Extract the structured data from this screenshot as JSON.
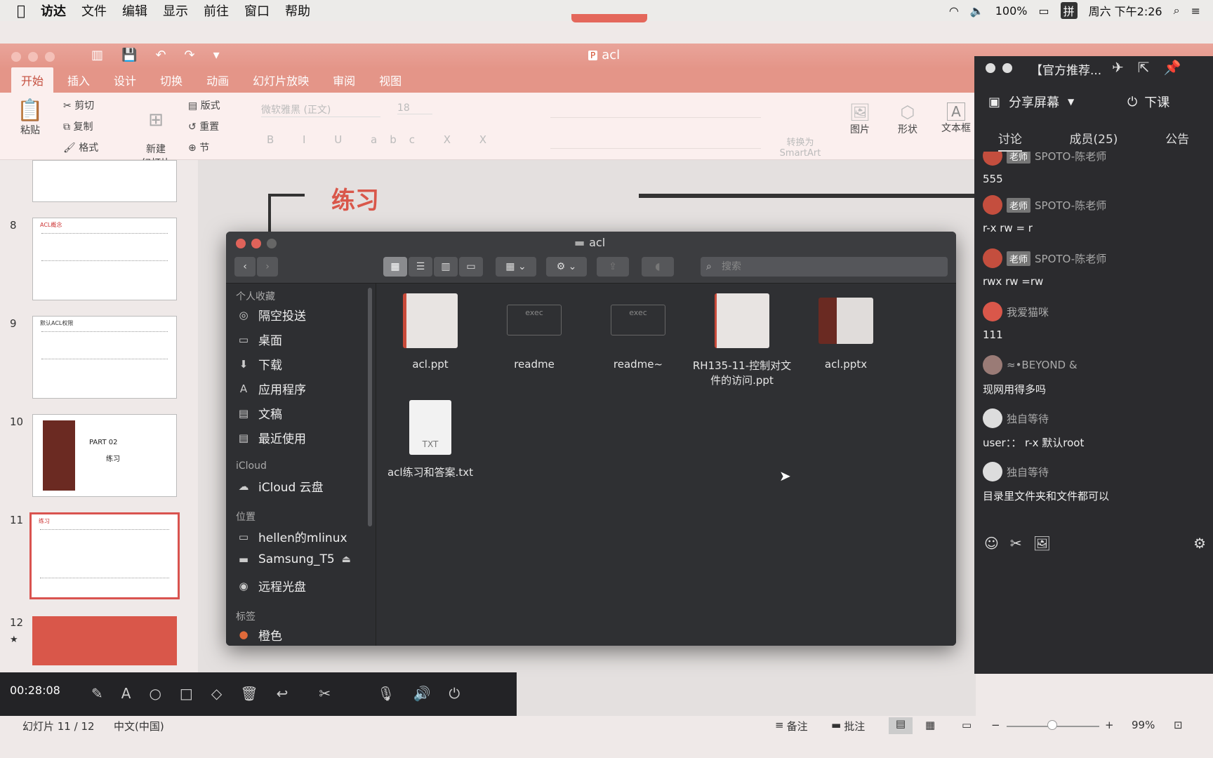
{
  "menubar": {
    "apple": "",
    "items": [
      "访达",
      "文件",
      "编辑",
      "显示",
      "前往",
      "窗口",
      "帮助"
    ],
    "battery": "100%",
    "input_method": "拼",
    "clock": "周六 下午2:26"
  },
  "ppt": {
    "title": "acl",
    "tabs": [
      "开始",
      "插入",
      "设计",
      "切换",
      "动画",
      "幻灯片放映",
      "审阅",
      "视图"
    ],
    "ribbon": {
      "paste": "粘贴",
      "cut": "剪切",
      "copy": "复制",
      "format": "格式",
      "new_slide": "新建\n幻灯片",
      "layout": "版式",
      "reset": "重置",
      "section": "节",
      "font_name": "微软雅黑 (正文)",
      "font_size": "18",
      "smartart": "转换为\nSmartArt",
      "picture": "图片",
      "shape": "形状",
      "textbox": "文本框"
    },
    "slide_numbers": [
      "8",
      "9",
      "10",
      "11",
      "12"
    ],
    "thumb10_text": [
      "PART 02",
      "练习"
    ],
    "thumb8_title": "ACL概念",
    "thumb9_title": "默认ACL权限",
    "thumb11_title": "练习",
    "slide_title": "练习",
    "status": {
      "slide": "幻灯片 11 / 12",
      "lang": "中文(中国)",
      "notes": "备注",
      "comments": "批注",
      "zoom": "99%"
    }
  },
  "recorder": {
    "time": "00:28:08"
  },
  "finder": {
    "title": "acl",
    "search_placeholder": "搜索",
    "sidebar": {
      "favorites_header": "个人收藏",
      "favorites": [
        "隔空投送",
        "桌面",
        "下载",
        "应用程序",
        "文稿",
        "最近使用"
      ],
      "icloud_header": "iCloud",
      "icloud": [
        "iCloud 云盘"
      ],
      "locations_header": "位置",
      "locations": [
        "hellen的mlinux",
        "Samsung_T5",
        "远程光盘"
      ],
      "tags_header": "标签",
      "tags": [
        "橙色"
      ]
    },
    "files": [
      {
        "name": "acl.ppt",
        "kind": "ppt"
      },
      {
        "name": "readme",
        "kind": "exec",
        "badge": "exec"
      },
      {
        "name": "readme~",
        "kind": "exec",
        "badge": "exec"
      },
      {
        "name": "RH135-11-控制对文件的访问.ppt",
        "kind": "ppt"
      },
      {
        "name": "acl.pptx",
        "kind": "pptx"
      },
      {
        "name": "acl练习和答案.txt",
        "kind": "txt",
        "badge": "TXT"
      }
    ]
  },
  "chat": {
    "title": "【官方推荐...",
    "share_screen": "分享屏幕",
    "end_class": "下课",
    "tabs": [
      "讨论",
      "成员(25)",
      "公告"
    ],
    "messages": [
      {
        "user": "SPOTO-陈老师",
        "badge": "老师",
        "text": "555"
      },
      {
        "user": "SPOTO-陈老师",
        "badge": "老师",
        "text": "r-x    rw    = r"
      },
      {
        "user": "SPOTO-陈老师",
        "badge": "老师",
        "text": "rwx   rw    =rw"
      },
      {
        "user": "我爱猫咪",
        "badge": "",
        "text": "111"
      },
      {
        "user": "≈•BEYOND &",
        "badge": "",
        "text": "现网用得多吗"
      },
      {
        "user": "独自等待",
        "badge": "",
        "text": "user：：  r-x   默认root"
      },
      {
        "user": "独自等待",
        "badge": "",
        "text": "目录里文件夹和文件都可以"
      }
    ]
  },
  "colors": {
    "ppt_accent": "#e49588",
    "ppt_active": "#c44e3e",
    "finder_bg": "#2f3033",
    "chat_bg": "#2b2b2e"
  }
}
